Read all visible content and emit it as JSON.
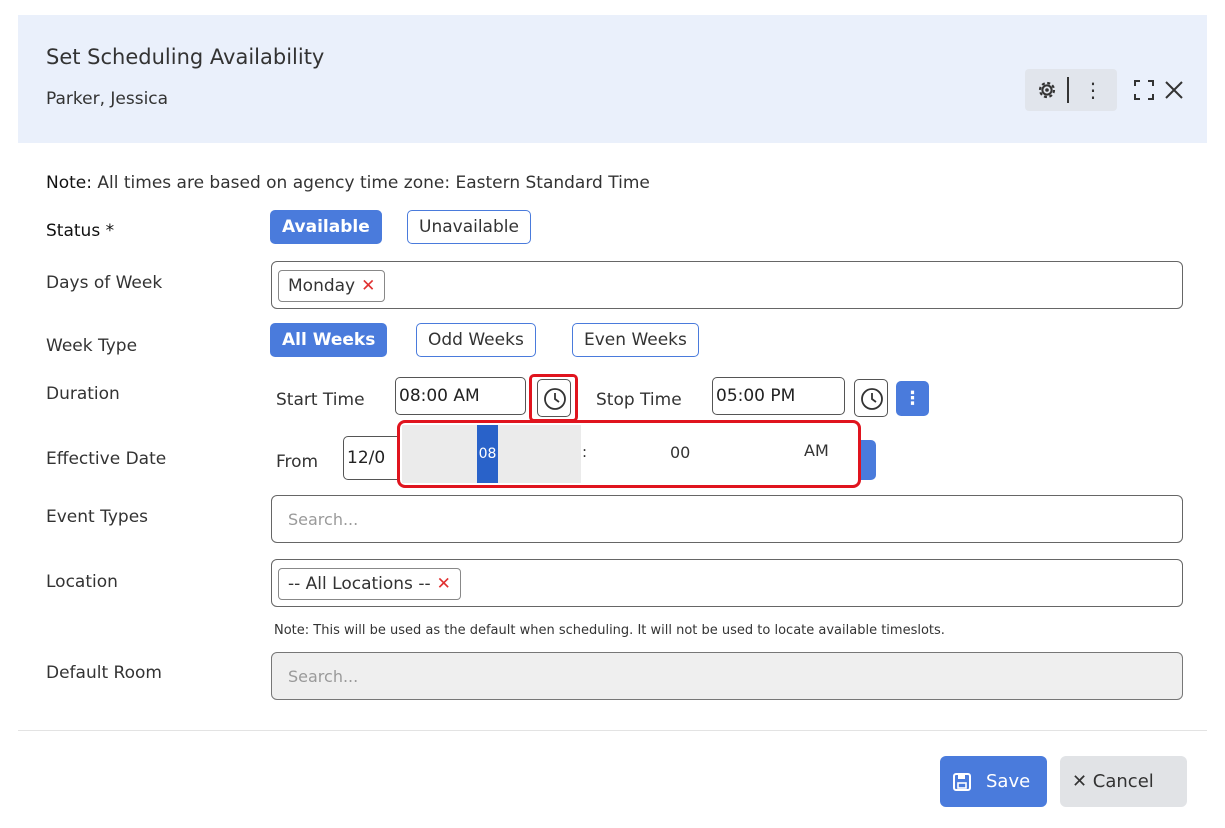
{
  "header": {
    "title": "Set Scheduling Availability",
    "subtitle": "Parker, Jessica",
    "menu_glyph": "⋮",
    "close_glyph": "✕"
  },
  "note_top": {
    "prefix": "Note:",
    "text": " All times are based on agency time zone: Eastern Standard Time"
  },
  "status": {
    "label": "Status *",
    "options": [
      "Available",
      "Unavailable"
    ],
    "selected": "Available"
  },
  "days_of_week": {
    "label": "Days of Week",
    "chips": [
      "Monday"
    ],
    "remove_glyph": "✕"
  },
  "week_type": {
    "label": "Week Type",
    "options": [
      "All Weeks",
      "Odd Weeks",
      "Even Weeks"
    ],
    "selected": "All Weeks"
  },
  "duration": {
    "label": "Duration",
    "start_label": "Start Time",
    "start_value": "08:00 AM",
    "stop_label": "Stop Time",
    "stop_value": "05:00 PM",
    "menu_glyph": "⋮"
  },
  "time_picker": {
    "hour": "08",
    "separator": ":",
    "minute": "00",
    "period": "AM"
  },
  "effective_date": {
    "label": "Effective Date",
    "from_label": "From",
    "from_value": "12/0"
  },
  "event_types": {
    "label": "Event Types",
    "placeholder": "Search..."
  },
  "location": {
    "label": "Location",
    "chips": [
      "-- All Locations --"
    ],
    "remove_glyph": "✕",
    "note": "Note: This will be used as the default when scheduling. It will not be used to locate available timeslots."
  },
  "default_room": {
    "label": "Default Room",
    "placeholder": "Search..."
  },
  "footer": {
    "save_label": "Save",
    "cancel_label": "✕  Cancel"
  },
  "colors": {
    "accent": "#4a7bdc",
    "header_bg": "#eaf0fb",
    "highlight": "#e0141e",
    "remove": "#e03131"
  },
  "icons": [
    "gear-icon",
    "kebab-menu-icon",
    "expand-icon",
    "close-icon",
    "clock-icon",
    "save-icon"
  ]
}
